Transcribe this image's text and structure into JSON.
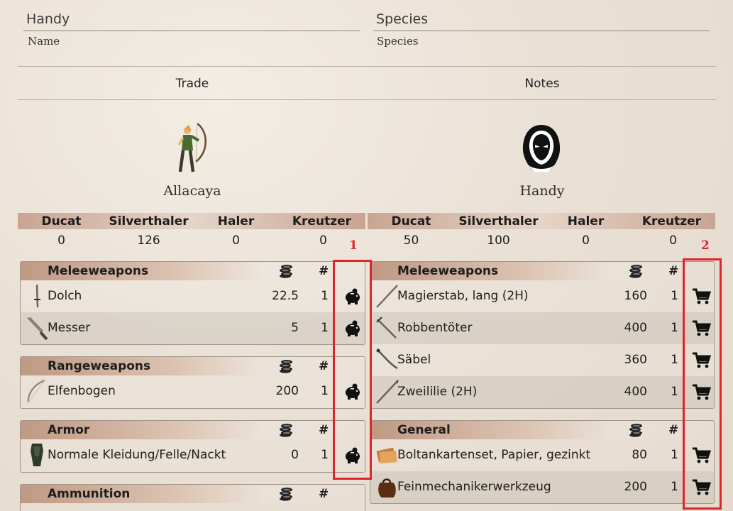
{
  "header": {
    "name_value": "Handy",
    "name_label": "Name",
    "species_value": "Species",
    "species_label": "Species"
  },
  "tabs": [
    {
      "label": "Trade"
    },
    {
      "label": "Notes"
    }
  ],
  "left_actor": {
    "name": "Allacaya",
    "currency": {
      "headers": [
        "Ducat",
        "Silverthaler",
        "Haler",
        "Kreutzer"
      ],
      "values": [
        "0",
        "126",
        "0",
        "0"
      ]
    },
    "sections": [
      {
        "title": "Meleeweapons",
        "hash": "#",
        "items": [
          {
            "name": "Dolch",
            "price": "22.5",
            "qty": "1",
            "icon": "dagger-icon",
            "action": "piggy-bank-icon"
          },
          {
            "name": "Messer",
            "price": "5",
            "qty": "1",
            "icon": "knife-icon",
            "action": "piggy-bank-icon"
          }
        ]
      },
      {
        "title": "Rangeweapons",
        "hash": "#",
        "items": [
          {
            "name": "Elfenbogen",
            "price": "200",
            "qty": "1",
            "icon": "bow-icon",
            "action": "piggy-bank-icon"
          }
        ]
      },
      {
        "title": "Armor",
        "hash": "#",
        "items": [
          {
            "name": "Normale Kleidung/Felle/Nackt",
            "price": "0",
            "qty": "1",
            "icon": "clothing-icon",
            "action": "piggy-bank-icon"
          }
        ]
      },
      {
        "title": "Ammunition",
        "hash": "#",
        "items": []
      }
    ]
  },
  "right_actor": {
    "name": "Handy",
    "currency": {
      "headers": [
        "Ducat",
        "Silverthaler",
        "Haler",
        "Kreutzer"
      ],
      "values": [
        "50",
        "100",
        "0",
        "0"
      ]
    },
    "sections": [
      {
        "title": "Meleeweapons",
        "hash": "#",
        "items": [
          {
            "name": "Magierstab, lang (2H)",
            "price": "160",
            "qty": "1",
            "icon": "staff-icon",
            "action": "cart-icon"
          },
          {
            "name": "Robbentöter",
            "price": "400",
            "qty": "1",
            "icon": "sword-icon",
            "action": "cart-icon"
          },
          {
            "name": "Säbel",
            "price": "360",
            "qty": "1",
            "icon": "saber-icon",
            "action": "cart-icon"
          },
          {
            "name": "Zweililie (2H)",
            "price": "400",
            "qty": "1",
            "icon": "polearm-icon",
            "action": "cart-icon"
          }
        ]
      },
      {
        "title": "General",
        "hash": "#",
        "items": [
          {
            "name": "Boltankartenset, Papier, gezinkt",
            "price": "80",
            "qty": "1",
            "icon": "cards-icon",
            "action": "cart-icon"
          },
          {
            "name": "Feinmechanikerwerkzeug",
            "price": "200",
            "qty": "1",
            "icon": "tool-bag-icon",
            "action": "cart-icon"
          }
        ]
      }
    ]
  },
  "annotations": [
    {
      "label": "1"
    },
    {
      "label": "2"
    }
  ],
  "colors": {
    "highlight": "#e0242c",
    "header_gradient": "#c8a592",
    "background": "#ece4da"
  }
}
